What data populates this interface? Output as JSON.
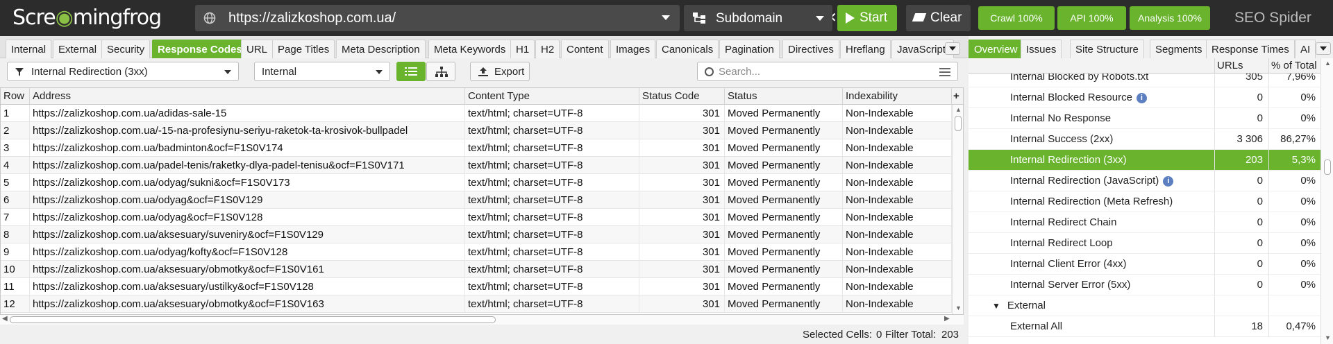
{
  "app": {
    "logo": {
      "part1": "Scre",
      "part2": "mingfrog"
    },
    "url": "https://zalizkoshop.com.ua/",
    "mode": "Subdomain",
    "start_label": "Start",
    "clear_label": "Clear",
    "crawl_status": "Crawl 100%",
    "api_status": "API 100%",
    "analysis_status": "Analysis 100%",
    "product_name": "SEO Spider",
    "clear_url_glyph": "✕"
  },
  "tabs": [
    {
      "label": "Internal"
    },
    {
      "label": "External"
    },
    {
      "label": "Security"
    },
    {
      "label": "Response Codes"
    },
    {
      "label": "URL"
    },
    {
      "label": "Page Titles"
    },
    {
      "label": "Meta Description"
    },
    {
      "label": "Meta Keywords"
    },
    {
      "label": "H1"
    },
    {
      "label": "H2"
    },
    {
      "label": "Content"
    },
    {
      "label": "Images"
    },
    {
      "label": "Canonicals"
    },
    {
      "label": "Pagination"
    },
    {
      "label": "Directives"
    },
    {
      "label": "Hreflang"
    },
    {
      "label": "JavaScript"
    }
  ],
  "active_tab": "Response Codes",
  "filter": {
    "selected": "Internal Redirection (3xx)",
    "scope": "Internal",
    "export_label": "Export",
    "search_placeholder": "Search..."
  },
  "table": {
    "columns": [
      "Row",
      "Address",
      "Content Type",
      "Status Code",
      "Status",
      "Indexability"
    ],
    "rows": [
      [
        "1",
        "https://zalizkoshop.com.ua/adidas-sale-15",
        "text/html; charset=UTF-8",
        "301",
        "Moved Permanently",
        "Non-Indexable"
      ],
      [
        "2",
        "https://zalizkoshop.com.ua/-15-na-profesiynu-seriyu-raketok-ta-krosivok-bullpadel",
        "text/html; charset=UTF-8",
        "301",
        "Moved Permanently",
        "Non-Indexable"
      ],
      [
        "3",
        "https://zalizkoshop.com.ua/badminton&ocf=F1S0V174",
        "text/html; charset=UTF-8",
        "301",
        "Moved Permanently",
        "Non-Indexable"
      ],
      [
        "4",
        "https://zalizkoshop.com.ua/padel-tenis/raketky-dlya-padel-tenisu&ocf=F1S0V171",
        "text/html; charset=UTF-8",
        "301",
        "Moved Permanently",
        "Non-Indexable"
      ],
      [
        "5",
        "https://zalizkoshop.com.ua/odyag/sukni&ocf=F1S0V173",
        "text/html; charset=UTF-8",
        "301",
        "Moved Permanently",
        "Non-Indexable"
      ],
      [
        "6",
        "https://zalizkoshop.com.ua/odyag&ocf=F1S0V129",
        "text/html; charset=UTF-8",
        "301",
        "Moved Permanently",
        "Non-Indexable"
      ],
      [
        "7",
        "https://zalizkoshop.com.ua/odyag&ocf=F1S0V128",
        "text/html; charset=UTF-8",
        "301",
        "Moved Permanently",
        "Non-Indexable"
      ],
      [
        "8",
        "https://zalizkoshop.com.ua/aksesuary/suveniry&ocf=F1S0V129",
        "text/html; charset=UTF-8",
        "301",
        "Moved Permanently",
        "Non-Indexable"
      ],
      [
        "9",
        "https://zalizkoshop.com.ua/odyag/kofty&ocf=F1S0V128",
        "text/html; charset=UTF-8",
        "301",
        "Moved Permanently",
        "Non-Indexable"
      ],
      [
        "10",
        "https://zalizkoshop.com.ua/aksesuary/obmotky&ocf=F1S0V161",
        "text/html; charset=UTF-8",
        "301",
        "Moved Permanently",
        "Non-Indexable"
      ],
      [
        "11",
        "https://zalizkoshop.com.ua/aksesuary/ustilky&ocf=F1S0V128",
        "text/html; charset=UTF-8",
        "301",
        "Moved Permanently",
        "Non-Indexable"
      ],
      [
        "12",
        "https://zalizkoshop.com.ua/aksesuary/obmotky&ocf=F1S0V163",
        "text/html; charset=UTF-8",
        "301",
        "Moved Permanently",
        "Non-Indexable"
      ]
    ],
    "add_column_glyph": "+"
  },
  "status": {
    "selected_cells_label": "Selected Cells:",
    "selected_cells_value": "0",
    "filter_total_label": "Filter Total:",
    "filter_total_value": "203"
  },
  "right": {
    "tabs": [
      {
        "label": "Overview"
      },
      {
        "label": "Issues"
      },
      {
        "label": "Site Structure"
      },
      {
        "label": "Segments"
      },
      {
        "label": "Response Times"
      },
      {
        "label": "AI"
      }
    ],
    "active_tab": "Overview",
    "col_urls": "URLs",
    "col_pct": "% of Total",
    "rows": [
      {
        "name": "Internal Blocked by Robots.txt",
        "urls": "305",
        "pct": "7,96%"
      },
      {
        "name": "Internal Blocked Resource",
        "urls": "0",
        "pct": "0%",
        "info": "i"
      },
      {
        "name": "Internal No Response",
        "urls": "0",
        "pct": "0%"
      },
      {
        "name": "Internal Success (2xx)",
        "urls": "3 306",
        "pct": "86,27%"
      },
      {
        "name": "Internal Redirection (3xx)",
        "urls": "203",
        "pct": "5,3%"
      },
      {
        "name": "Internal Redirection (JavaScript)",
        "urls": "0",
        "pct": "0%",
        "info": "i"
      },
      {
        "name": "Internal Redirection (Meta Refresh)",
        "urls": "0",
        "pct": "0%"
      },
      {
        "name": "Internal Redirect Chain",
        "urls": "0",
        "pct": "0%"
      },
      {
        "name": "Internal Redirect Loop",
        "urls": "0",
        "pct": "0%"
      },
      {
        "name": "Internal Client Error (4xx)",
        "urls": "0",
        "pct": "0%"
      },
      {
        "name": "Internal Server Error (5xx)",
        "urls": "0",
        "pct": "0%"
      },
      {
        "name": "External",
        "urls": "",
        "pct": "",
        "group": true,
        "expanded_glyph": "▼"
      },
      {
        "name": "External All",
        "urls": "18",
        "pct": "0,47%"
      }
    ]
  },
  "colors": {
    "accent": "#6ab42d",
    "topbar": "#2c2c2c"
  }
}
